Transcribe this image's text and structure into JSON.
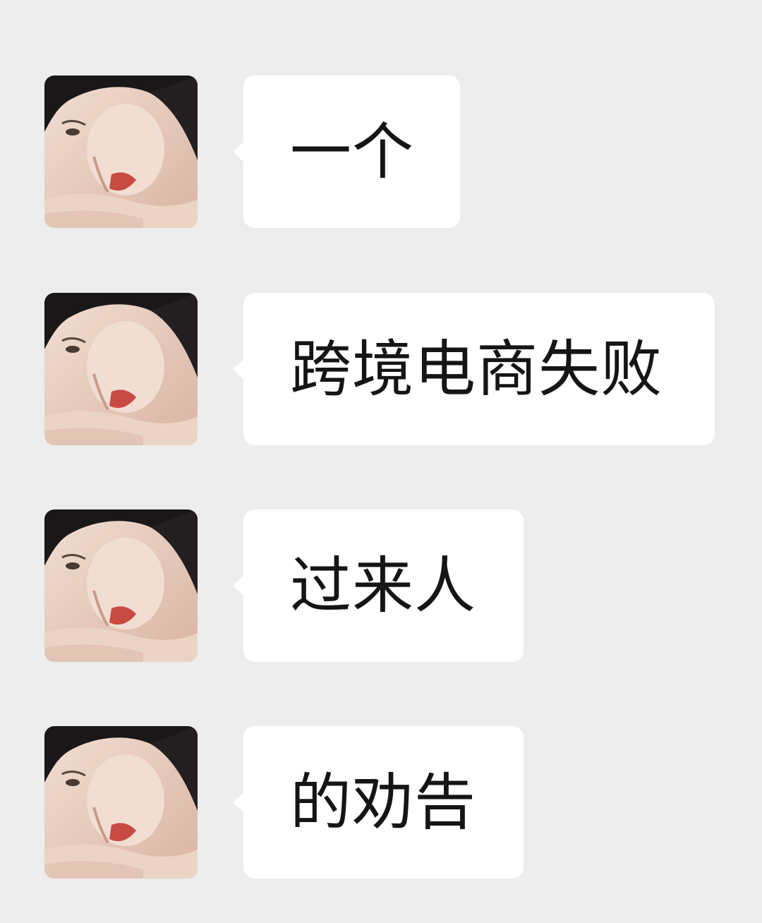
{
  "messages": [
    {
      "sender": "other",
      "avatar": "woman-portrait-avatar",
      "text": "一个"
    },
    {
      "sender": "other",
      "avatar": "woman-portrait-avatar",
      "text": "跨境电商失败"
    },
    {
      "sender": "other",
      "avatar": "woman-portrait-avatar",
      "text": "过来人"
    },
    {
      "sender": "other",
      "avatar": "woman-portrait-avatar",
      "text": "的劝告"
    }
  ],
  "colors": {
    "background": "#ededed",
    "bubble": "#ffffff",
    "text": "#151515"
  }
}
